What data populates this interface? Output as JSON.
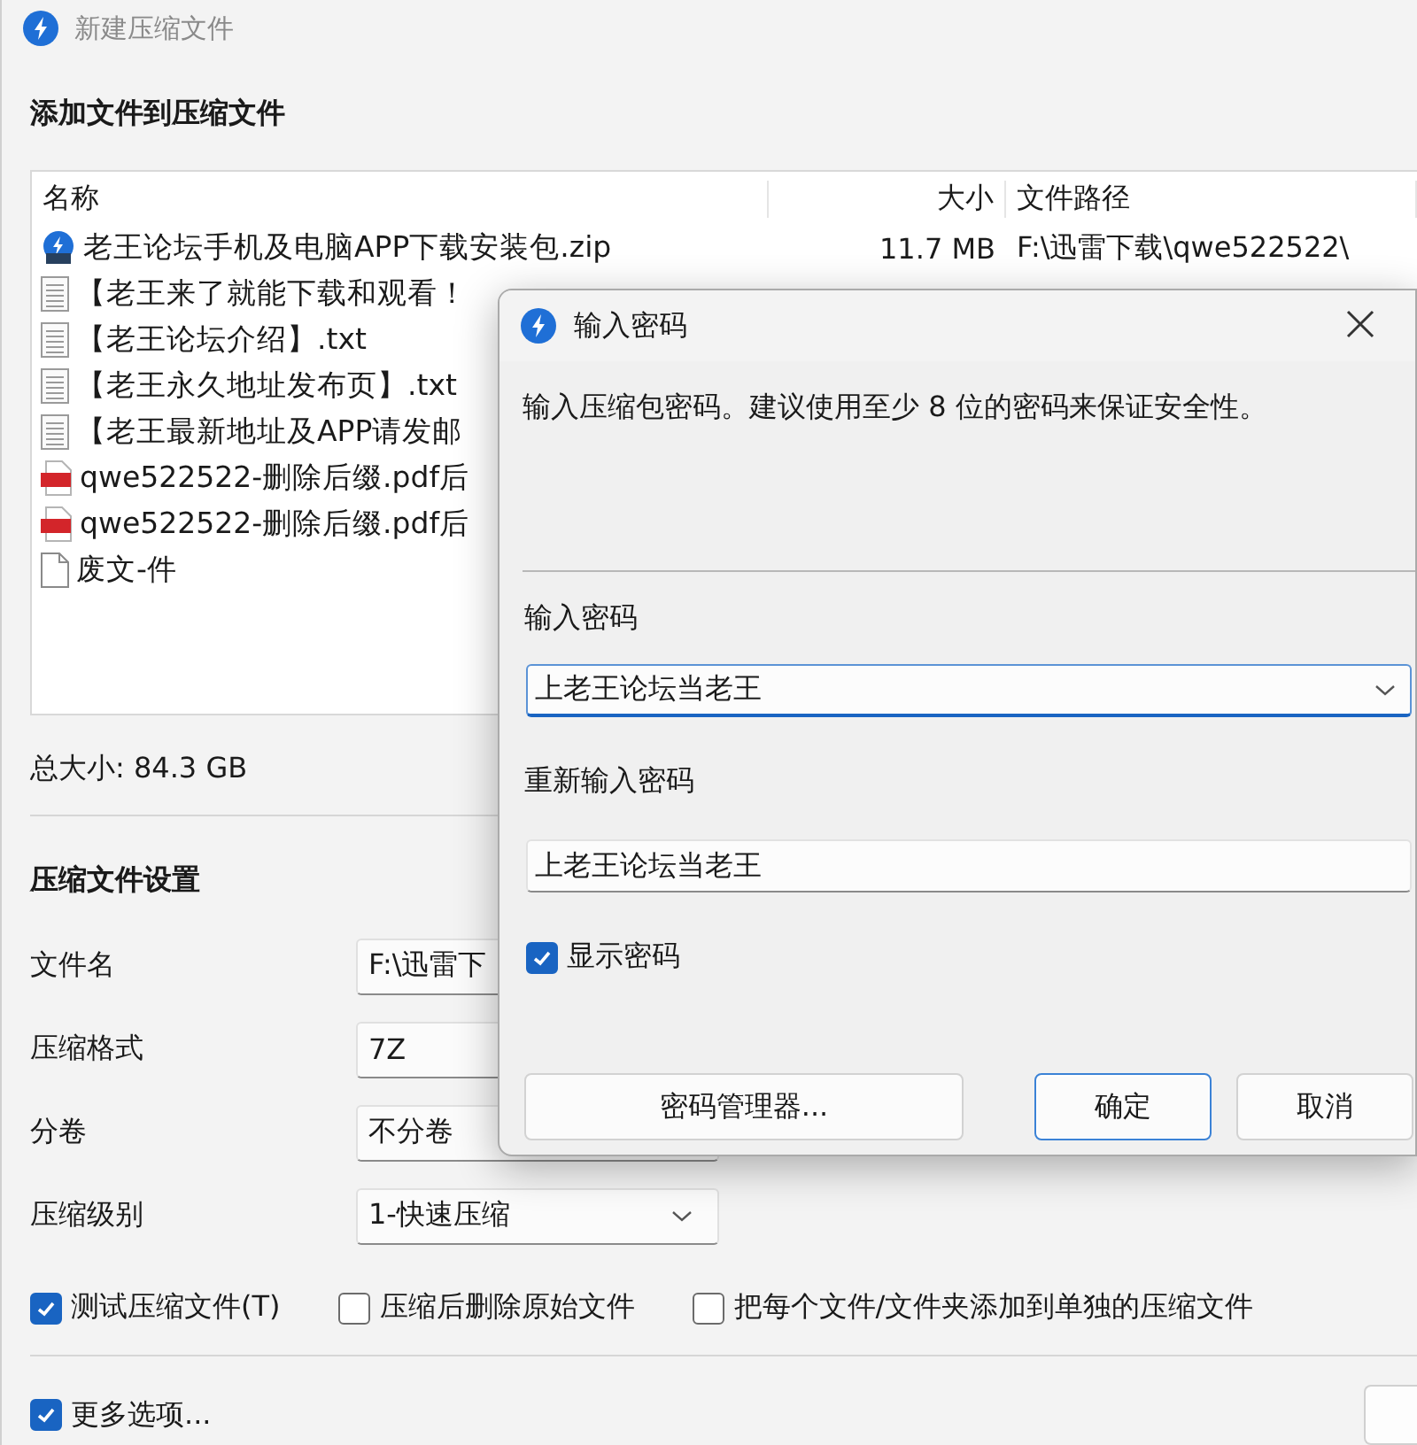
{
  "window": {
    "title": "新建压缩文件"
  },
  "heading": "添加文件到压缩文件",
  "file_list": {
    "columns": [
      "名称",
      "大小",
      "文件路径"
    ],
    "rows": [
      {
        "kind": "zip",
        "name": "老王论坛手机及电脑APP下载安装包.zip",
        "size": "11.7 MB",
        "path": "F:\\迅雷下载\\qwe522522\\"
      },
      {
        "kind": "text",
        "name": "【老王来了就能下载和观看！"
      },
      {
        "kind": "text",
        "name": "【老王论坛介绍】.txt"
      },
      {
        "kind": "text",
        "name": "【老王永久地址发布页】.txt"
      },
      {
        "kind": "text",
        "name": "【老王最新地址及APP请发邮"
      },
      {
        "kind": "pdf",
        "name": "qwe522522-删除后缀.pdf后"
      },
      {
        "kind": "pdf",
        "name": "qwe522522-删除后缀.pdf后"
      },
      {
        "kind": "blank",
        "name": "废文-件"
      }
    ]
  },
  "total_size": "总大小: 84.3 GB",
  "settings": {
    "title": "压缩文件设置",
    "fields": [
      {
        "kind": "text",
        "label": "文件名",
        "value": "F:\\迅雷下"
      },
      {
        "kind": "text",
        "label": "压缩格式",
        "value": "7Z"
      },
      {
        "kind": "text",
        "label": "分卷",
        "value": "不分卷"
      },
      {
        "kind": "dropdown",
        "label": "压缩级别",
        "value": "1-快速压缩"
      }
    ],
    "options": [
      {
        "label": "测试压缩文件(T)",
        "checked": true
      },
      {
        "label": "压缩后删除原始文件",
        "checked": false
      },
      {
        "label": "把每个文件/文件夹添加到单独的压缩文件",
        "checked": false
      }
    ]
  },
  "more_options": {
    "label": "更多选项...",
    "checked": true
  },
  "dialog": {
    "title": "输入密码",
    "message": "输入压缩包密码。建议使用至少 8 位的密码来保证安全性。",
    "password_label": "输入密码",
    "password": "上老王论坛当老王",
    "confirm_label": "重新输入密码",
    "confirm": "上老王论坛当老王",
    "show_password": {
      "label": "显示密码",
      "checked": true
    },
    "buttons": [
      {
        "label": "密码管理器...",
        "default": false
      },
      {
        "label": "确定",
        "default": true
      },
      {
        "label": "取消",
        "default": false
      }
    ]
  }
}
